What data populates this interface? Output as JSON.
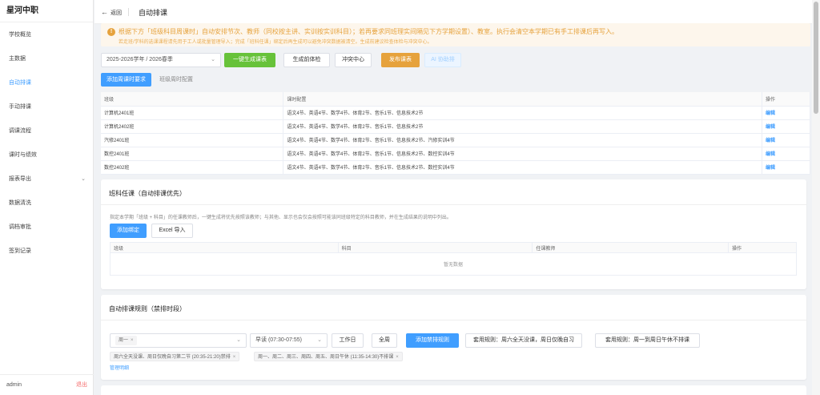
{
  "sidebar": {
    "brand": "星河中职",
    "items": [
      {
        "label": "学校概览"
      },
      {
        "label": "主数据"
      },
      {
        "label": "自动排课"
      },
      {
        "label": "手动排课"
      },
      {
        "label": "调课流程"
      },
      {
        "label": "课时与绩效"
      },
      {
        "label": "报表导出"
      },
      {
        "label": "数据清洗"
      },
      {
        "label": "调档审批"
      },
      {
        "label": "签到记录"
      }
    ],
    "user": "admin",
    "logout": "退出"
  },
  "header": {
    "back_label": "返回",
    "title": "自动排课"
  },
  "notice": {
    "line1": "根据下方「班级科目周课时」自动安排节次、教师（同校按主讲、实训按实训科目）；若再要求同班理实间隔见下方学期设置）、教室。执行会清空本学期已有手工排课后再写入。",
    "line2": "若走班/学科的选课课程请先用于工人或批量管理导入；完成「班科任课」绑定后再生成可以避免冲突数据被清空。生成前建议检查体检与冲突中心。"
  },
  "toolbar": {
    "term": "2025-2026学年 / 2026春季",
    "generate": "一键生成课表",
    "precheck": "生成前体检",
    "conflict": "冲突中心",
    "publish": "发布课表",
    "ai": "AI 协助排"
  },
  "tabs": {
    "add_weekly": "添加周课时要求",
    "class_weekly": "班级周时配置"
  },
  "course_table": {
    "headers": [
      "班级",
      "课时配置",
      "操作"
    ],
    "rows": [
      {
        "class": "计算机2401班",
        "config": "语文4节、英语4节、数学4节、体育2节、音乐1节、信息技术2节",
        "op": "编辑"
      },
      {
        "class": "计算机2402班",
        "config": "语文4节、英语4节、数学4节、体育2节、音乐1节、信息技术2节",
        "op": "编辑"
      },
      {
        "class": "汽修2401班",
        "config": "语文4节、英语4节、数学4节、体育2节、音乐1节、信息技术2节、汽修实训4节",
        "op": "编辑"
      },
      {
        "class": "数控2401班",
        "config": "语文4节、英语4节、数学4节、体育2节、音乐1节、信息技术2节、数控实训4节",
        "op": "编辑"
      },
      {
        "class": "数控2402班",
        "config": "语文4节、英语4节、数学4节、体育2节、音乐1节、信息技术2节、数控实训4节",
        "op": "编辑"
      }
    ]
  },
  "assign_card": {
    "title": "班科任课（自动排课优先）",
    "desc": "指定本学期「班级 + 科目」的任课教师后，一键生成将优先按照该教师；与其他、显示也会仅会按照可能该同班级特定的科目教师，并在生成结果的说明中列出。",
    "add_button": "添加绑定",
    "import_button": "Excel 导入",
    "headers": [
      "班级",
      "科目",
      "任课教师",
      "操作"
    ],
    "empty": "暂无数据"
  },
  "rule_card": {
    "title": "自动排课规则（禁排时段）",
    "weekday_value": "周一",
    "slot_value": "早读 (07:30-07:55)",
    "workday_btn": "工作日",
    "allweek_btn": "全周",
    "add_rule_btn": "添加禁排规则",
    "preset1": "套用规则：周六全天没课，周日仅晚自习",
    "preset2": "套用规则：周一到周日午休不排课",
    "tag1": "周六全天没课、周日仅晚自习第二节 (20:35-21:20)禁排",
    "tag2": "周一、周二、周三、周四、周五、周日午休 (11:35-14:30)不排课",
    "manage_link": "管理明细"
  }
}
